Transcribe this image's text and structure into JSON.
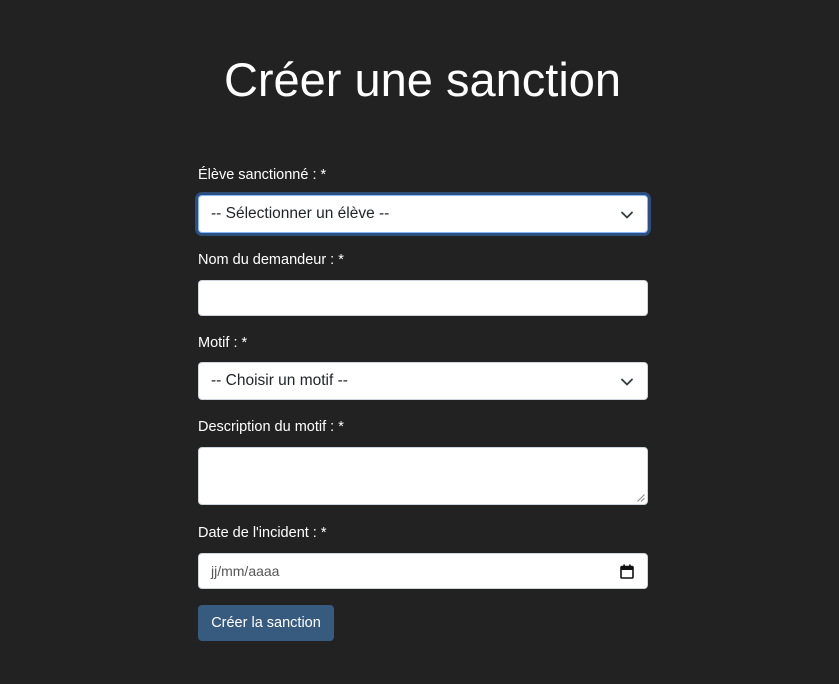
{
  "page": {
    "title": "Créer une sanction"
  },
  "form": {
    "student": {
      "label": "Élève sanctionné : *",
      "selected": "-- Sélectionner un élève --"
    },
    "requester": {
      "label": "Nom du demandeur : *",
      "value": ""
    },
    "reason": {
      "label": "Motif : *",
      "selected": "-- Choisir un motif --"
    },
    "description": {
      "label": "Description du motif : *",
      "value": ""
    },
    "date": {
      "label": "Date de l'incident : *",
      "placeholder": "jj/mm/aaaa"
    },
    "submit_label": "Créer la sanction"
  },
  "colors": {
    "background": "#222222",
    "primary_button": "#375a7f",
    "focus_ring": "#2c4f7e"
  },
  "icons": {
    "select_arrow": "chevron-down-icon",
    "date_picker": "calendar-icon"
  }
}
